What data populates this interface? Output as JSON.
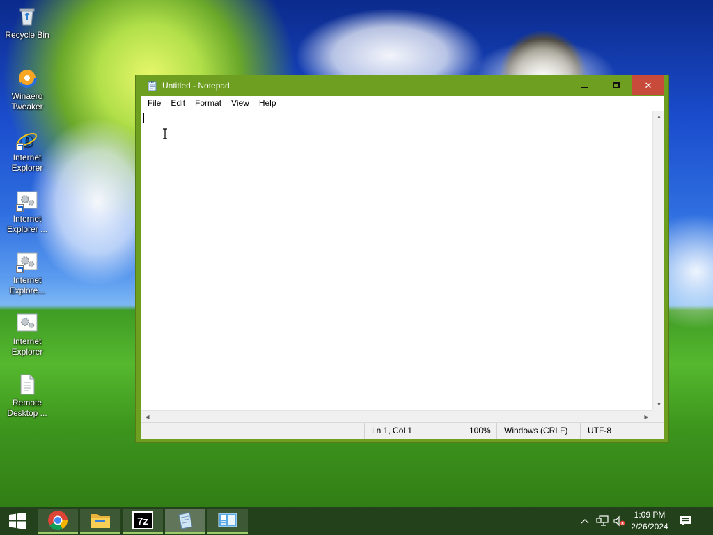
{
  "desktop": {
    "icons": [
      {
        "label": "Recycle Bin",
        "icon": "recycle-bin-icon"
      },
      {
        "label": "Winaero Tweaker",
        "icon": "winaero-tweaker-icon"
      },
      {
        "label": "Internet Explorer",
        "icon": "internet-explorer-icon"
      },
      {
        "label": "Internet Explorer ...",
        "icon": "settings-shortcut-icon"
      },
      {
        "label": "Internet Explore...",
        "icon": "settings-shortcut-icon"
      },
      {
        "label": "Internet Explorer",
        "icon": "settings-icon"
      },
      {
        "label": "Remote Desktop ...",
        "icon": "document-icon"
      }
    ]
  },
  "window": {
    "title": "Untitled - Notepad",
    "accent_color": "#6e9f21",
    "close_color": "#c74a3b",
    "controls": {
      "minimize": "minimize",
      "maximize": "maximize",
      "close": "✕"
    },
    "menu": [
      "File",
      "Edit",
      "Format",
      "View",
      "Help"
    ],
    "content": "",
    "status": {
      "position": "Ln 1, Col 1",
      "zoom": "100%",
      "line_ending": "Windows (CRLF)",
      "encoding": "UTF-8"
    }
  },
  "taskbar": {
    "apps": [
      "Google Chrome",
      "File Explorer",
      "7-Zip",
      "Notepad",
      "Control Panel"
    ],
    "active_app": "Notepad",
    "clock": {
      "time": "1:09 PM",
      "date": "2/26/2024"
    }
  }
}
